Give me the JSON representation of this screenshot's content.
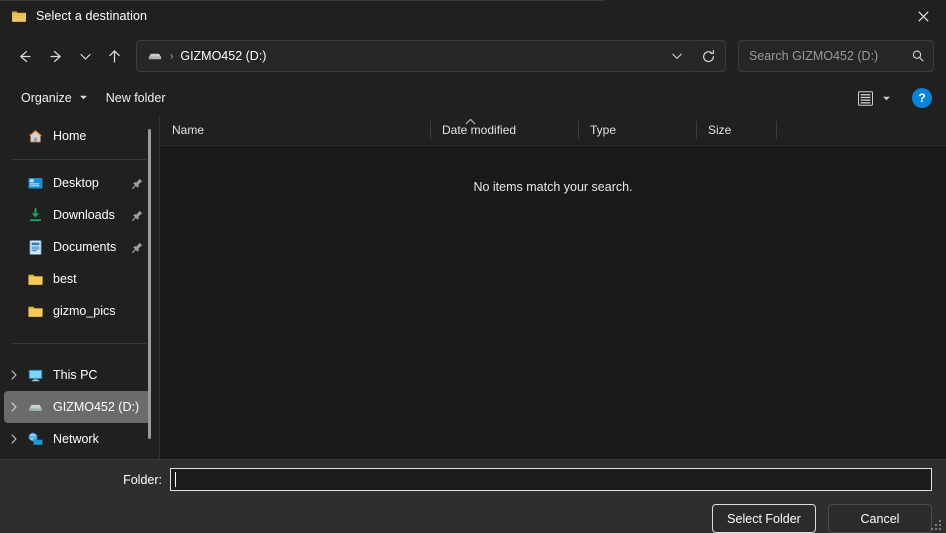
{
  "window": {
    "title": "Select a destination",
    "title_icon": "folder-icon",
    "close_label": "✕"
  },
  "nav": {
    "back_icon": "arrow-left-icon",
    "forward_icon": "arrow-right-icon",
    "recent_icon": "chevron-down-icon",
    "up_icon": "arrow-up-icon",
    "breadcrumb": {
      "drive_icon": "drive-icon",
      "separator": "›",
      "path": "GIZMO452 (D:)",
      "caret_icon": "chevron-down-icon"
    },
    "refresh_icon": "refresh-icon",
    "search": {
      "placeholder": "Search GIZMO452 (D:)",
      "value": "",
      "icon": "search-icon"
    }
  },
  "commandbar": {
    "organize": "Organize",
    "organize_caret": "▾",
    "new_folder": "New folder",
    "view_icon": "list-view-icon",
    "view_caret": "▾",
    "help": "?"
  },
  "sidebar": {
    "items": [
      {
        "label": "Home",
        "icon": "home-icon",
        "pinned": false,
        "chevron": false,
        "selected": false
      },
      {
        "separator": true
      },
      {
        "label": "Desktop",
        "icon": "desktop-icon",
        "pinned": true,
        "chevron": false,
        "selected": false
      },
      {
        "label": "Downloads",
        "icon": "downloads-icon",
        "pinned": true,
        "chevron": false,
        "selected": false
      },
      {
        "label": "Documents",
        "icon": "documents-icon",
        "pinned": true,
        "chevron": false,
        "selected": false
      },
      {
        "label": "best",
        "icon": "folder-icon",
        "pinned": false,
        "chevron": false,
        "selected": false
      },
      {
        "label": "gizmo_pics",
        "icon": "folder-icon",
        "pinned": false,
        "chevron": false,
        "selected": false
      },
      {
        "separator": true
      },
      {
        "label": "This PC",
        "icon": "this-pc-icon",
        "pinned": false,
        "chevron": true,
        "selected": false
      },
      {
        "label": "GIZMO452 (D:)",
        "icon": "drive-icon",
        "pinned": false,
        "chevron": true,
        "selected": true
      },
      {
        "label": "Network",
        "icon": "network-icon",
        "pinned": false,
        "chevron": true,
        "selected": false
      }
    ]
  },
  "file_list": {
    "columns": [
      {
        "label": "Name",
        "sorted": "ascending"
      },
      {
        "label": "Date modified",
        "sorted": ""
      },
      {
        "label": "Type",
        "sorted": ""
      },
      {
        "label": "Size",
        "sorted": ""
      }
    ],
    "sort_indicator": "˄",
    "empty_message": "No items match your search.",
    "rows": []
  },
  "footer": {
    "folder_label": "Folder:",
    "folder_value": "",
    "folder_placeholder": "",
    "select_button": "Select Folder",
    "cancel_button": "Cancel"
  },
  "colors": {
    "window_bg": "#202020",
    "content_bg": "#191919",
    "footer_bg": "#2e2e2e",
    "selection": "#6b6b6b",
    "accent_help": "#0a84d8",
    "folder_yellow": "#f3c44b",
    "text": "#ffffff"
  }
}
